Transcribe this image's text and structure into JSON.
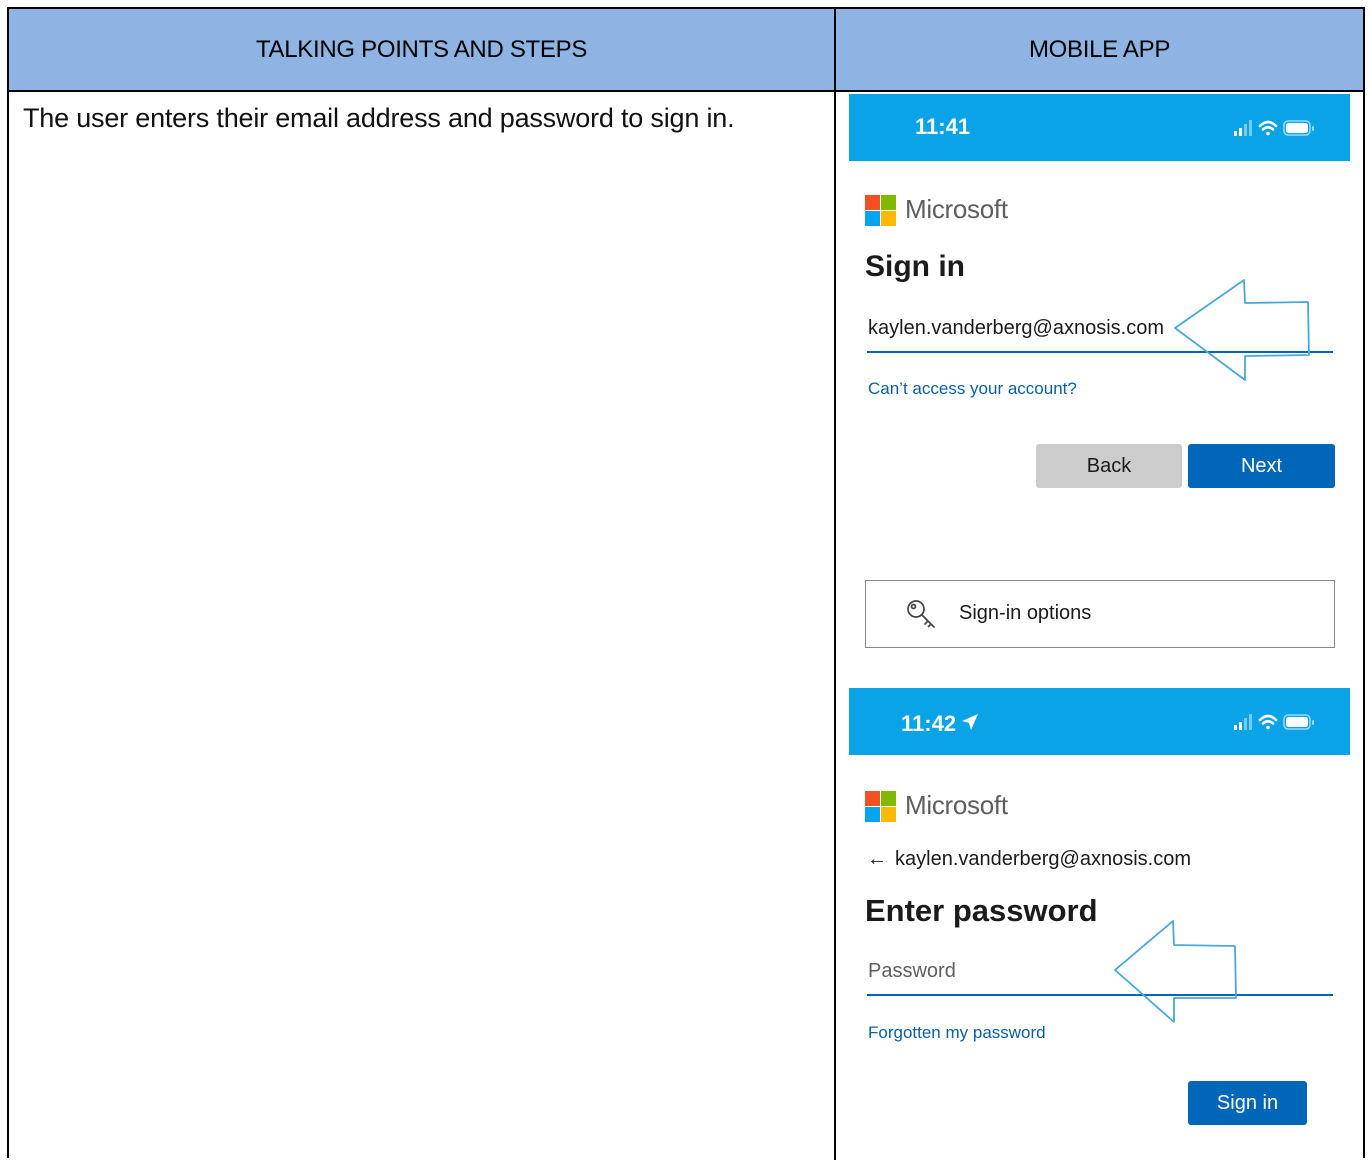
{
  "table": {
    "header_left": "TALKING POINTS AND STEPS",
    "header_right": "MOBILE APP",
    "step_text": "The user enters their email address and password to sign in."
  },
  "colors": {
    "header_bg": "#8eb4e3",
    "status_bar": "#0aa3e8",
    "primary_button": "#0067b8",
    "secondary_button": "#cccccc",
    "link": "#0b5fa8",
    "callout_arrow": "#4aa8d8"
  },
  "screen1": {
    "time": "11:41",
    "status_icons": [
      "signal-icon",
      "wifi-icon",
      "battery-icon"
    ],
    "brand": "Microsoft",
    "title": "Sign in",
    "email_value": "kaylen.vanderberg@axnosis.com",
    "link_text": "Can’t access your account?",
    "back_label": "Back",
    "next_label": "Next",
    "options_label": "Sign-in options",
    "options_icon": "key-icon"
  },
  "screen2": {
    "time": "11:42",
    "time_icon": "location-arrow-icon",
    "status_icons": [
      "signal-icon",
      "wifi-icon",
      "battery-icon"
    ],
    "brand": "Microsoft",
    "back_arrow": "←",
    "account": "kaylen.vanderberg@axnosis.com",
    "title": "Enter password",
    "password_placeholder": "Password",
    "link_text": "Forgotten my password",
    "signin_label": "Sign in"
  }
}
